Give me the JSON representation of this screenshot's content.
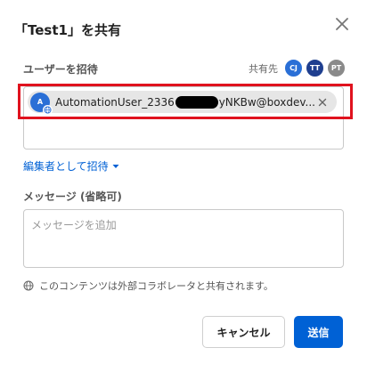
{
  "dialog": {
    "title": "「Test1」を共有"
  },
  "invite": {
    "label": "ユーザーを招待",
    "shared_with_label": "共有先",
    "collaborators": [
      {
        "initials": "CJ",
        "color": "#2a6fd6"
      },
      {
        "initials": "TT",
        "color": "#1f3f8f"
      },
      {
        "initials": "PT",
        "color": "#8a8a8a"
      }
    ],
    "pill": {
      "avatar_initials": "A",
      "email_prefix": "AutomationUser_2336",
      "email_suffix": "yNKBw@boxdev..."
    },
    "role_label": "編集者として招待"
  },
  "message": {
    "label": "メッセージ (省略可)",
    "placeholder": "メッセージを追加"
  },
  "notice": {
    "text": "このコンテンツは外部コラボレータと共有されます。"
  },
  "buttons": {
    "cancel": "キャンセル",
    "send": "送信"
  },
  "colors": {
    "primary": "#0061d5",
    "highlight_frame": "#e0121e"
  }
}
